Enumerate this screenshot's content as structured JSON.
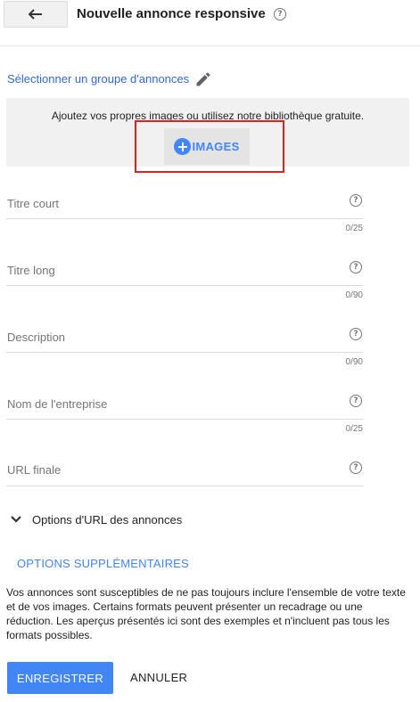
{
  "header": {
    "title": "Nouvelle annonce responsive",
    "help_icon": "help-circle-icon",
    "back_icon": "arrow-back-icon"
  },
  "ad_group": {
    "link_label": "Sélectionner un groupe d'annonces",
    "edit_icon": "pencil-icon"
  },
  "images": {
    "prompt": "Ajoutez vos propres images ou utilisez notre bibliothèque gratuite.",
    "button_label": "IMAGES",
    "button_icon": "plus-circle-icon",
    "highlight_color": "#e0201c"
  },
  "fields": {
    "short_title": {
      "label": "Titre court",
      "value": "",
      "counter": "0/25"
    },
    "long_title": {
      "label": "Titre long",
      "value": "",
      "counter": "0/90"
    },
    "description": {
      "label": "Description",
      "value": "",
      "counter": "0/90"
    },
    "business_name": {
      "label": "Nom de l'entreprise",
      "value": "",
      "counter": "0/25"
    },
    "final_url": {
      "label": "URL finale",
      "value": ""
    }
  },
  "url_options": {
    "label": "Options d'URL des annonces",
    "icon": "chevron-down-icon"
  },
  "extra_options_label": "OPTIONS SUPPLÉMENTAIRES",
  "notice": "Vos annonces sont susceptibles de ne pas toujours inclure l'ensemble de votre texte et de vos images. Certains formats peuvent présenter un recadrage ou une réduction. Les aperçus présentés ici sont des exemples et n'incluent pas tous les formats possibles.",
  "footer": {
    "save_label": "ENREGISTRER",
    "cancel_label": "ANNULER"
  },
  "colors": {
    "accent": "#4285f4",
    "link": "#3367d6",
    "panel_background": "#f1f1f1"
  }
}
